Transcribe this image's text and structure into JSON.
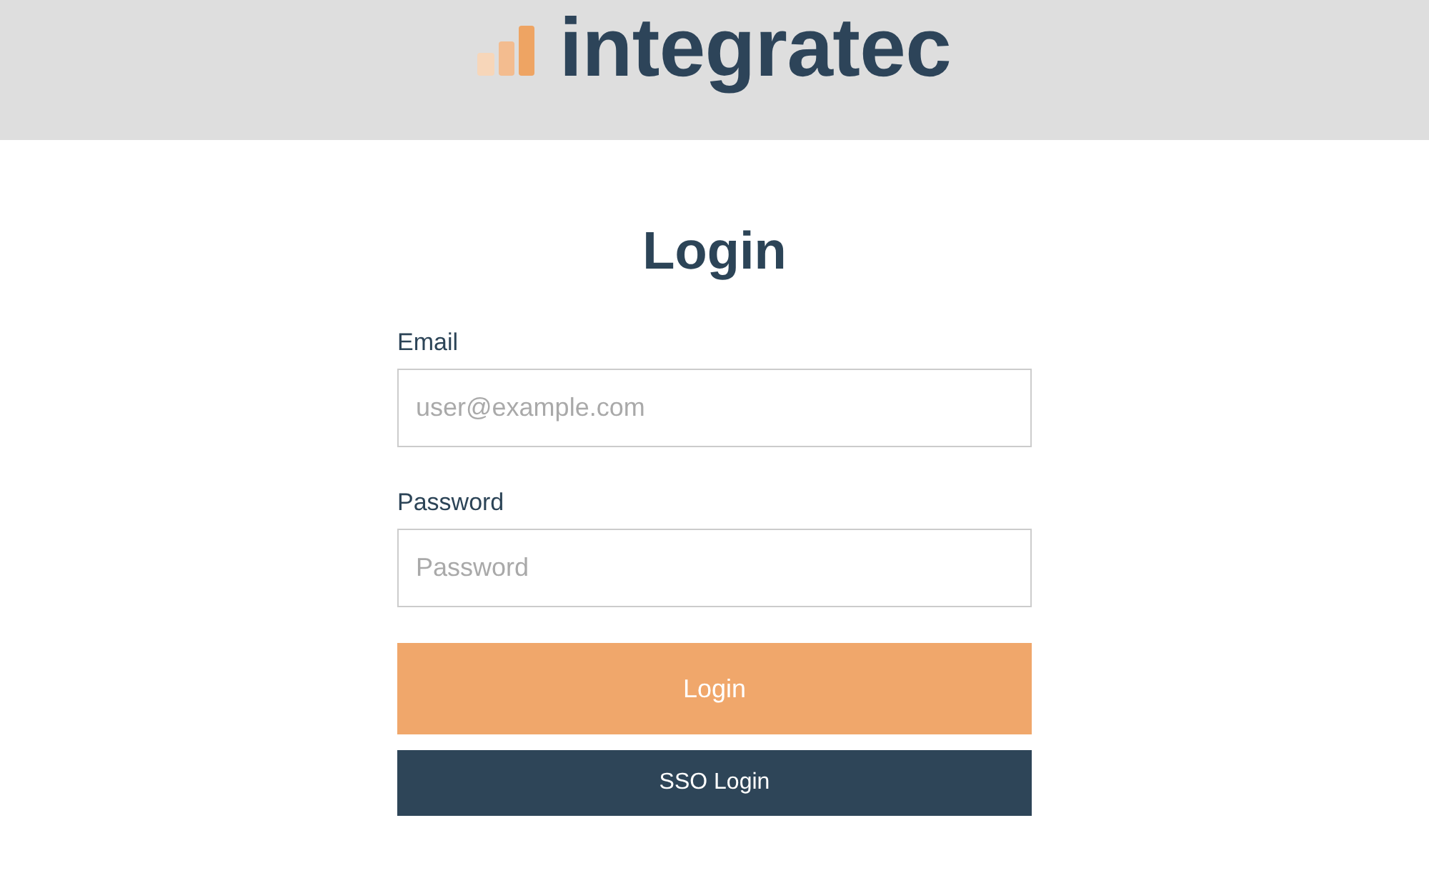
{
  "header": {
    "logo_text": "integratec"
  },
  "title": "Login",
  "fields": [
    {
      "label": "Email",
      "placeholder": "user@example.com"
    },
    {
      "label": "Password",
      "placeholder": "Password"
    }
  ],
  "buttons": [
    {
      "kind": "primary",
      "label": "Login"
    },
    {
      "kind": "secondary",
      "label": "SSO Login"
    }
  ]
}
